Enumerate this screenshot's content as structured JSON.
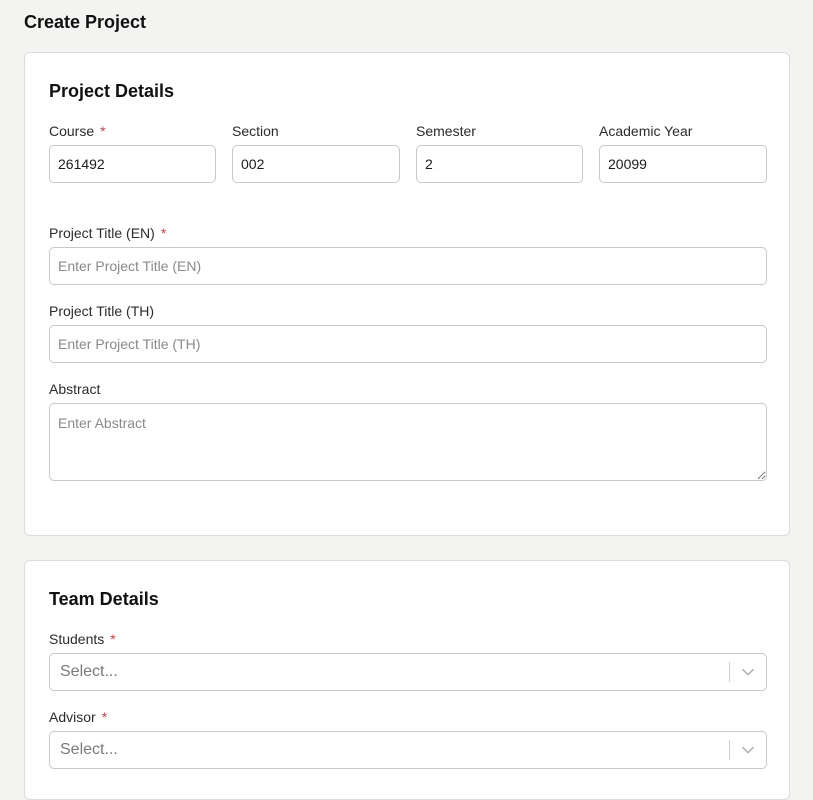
{
  "page": {
    "title": "Create Project"
  },
  "project_details": {
    "title": "Project Details",
    "course": {
      "label": "Course",
      "required_mark": "*",
      "value": "261492"
    },
    "section": {
      "label": "Section",
      "value": "002"
    },
    "semester": {
      "label": "Semester",
      "value": "2"
    },
    "academic_year": {
      "label": "Academic Year",
      "value": "20099"
    },
    "title_en": {
      "label": "Project Title (EN)",
      "required_mark": "*",
      "placeholder": "Enter Project Title (EN)",
      "value": ""
    },
    "title_th": {
      "label": "Project Title (TH)",
      "placeholder": "Enter Project Title (TH)",
      "value": ""
    },
    "abstract": {
      "label": "Abstract",
      "placeholder": "Enter Abstract",
      "value": ""
    }
  },
  "team_details": {
    "title": "Team Details",
    "students": {
      "label": "Students",
      "required_mark": "*",
      "placeholder": "Select..."
    },
    "advisor": {
      "label": "Advisor",
      "required_mark": "*",
      "placeholder": "Select..."
    }
  },
  "colors": {
    "required": "#e0393e",
    "border": "#c9c9c9",
    "background": "#f3f3f2"
  },
  "icons": {
    "dropdown": "chevron-down-icon",
    "textarea_resize": "resize-handle-icon"
  }
}
